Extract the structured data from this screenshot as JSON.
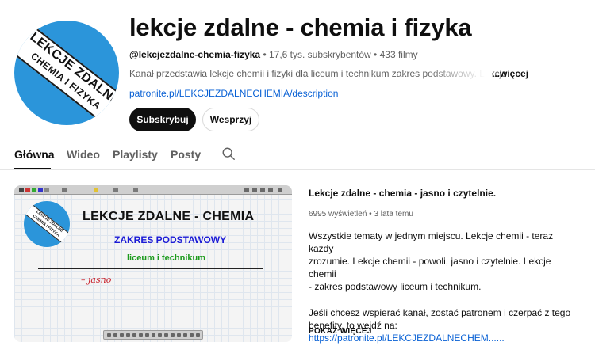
{
  "channel": {
    "title": "lekcje zdalne - chemia i fizyka",
    "handle": "@lekcjezdalne-chemia-fizyka",
    "subscribers": "17,6 tys. subskrybentów",
    "videos": "433 filmy",
    "separator": " • ",
    "description": "Kanał przedstawia lekcje chemii i fizyki dla liceum i technikum zakres podstawowy. Lekcje",
    "more_label": "...więcej",
    "link": "patronite.pl/LEKCJEZDALNECHEMIA/description",
    "avatar_text_line1": "LEKCJE ZDALNE",
    "avatar_text_line2": "CHEMIA I FIZYKA",
    "subscribe_label": "Subskrybuj",
    "support_label": "Wesprzyj"
  },
  "tabs": [
    {
      "label": "Główna",
      "active": true
    },
    {
      "label": "Wideo",
      "active": false
    },
    {
      "label": "Playlisty",
      "active": false
    },
    {
      "label": "Posty",
      "active": false
    }
  ],
  "featured": {
    "thumbnail": {
      "heading": "LEKCJE ZDALNE - CHEMIA",
      "subheading": "ZAKRES PODSTAWOWY",
      "subheading2": "liceum i technikum",
      "handwriting": "– jasno"
    },
    "title": "Lekcje zdalne - chemia - jasno i czytelnie.",
    "views": "6995 wyświetleń",
    "age": "3 lata temu",
    "description_lines": [
      "Wszystkie tematy w jednym miejscu. Lekcje chemii - teraz każdy",
      "zrozumie. Lekcje chemii - powoli, jasno i czytelnie. Lekcje chemii",
      "- zakres podstawowy liceum i technikum.",
      "Jeśli chcesz wspierać kanał, zostać patronem i czerpać z tego",
      "benefity, to wejdź na:"
    ],
    "description_link": "https://patronite.pl/LEKCJEZDALNECHEM......",
    "show_more_label": "POKAŻ WIĘCEJ"
  },
  "colors": {
    "accent_blue": "#2b95da",
    "link": "#065fd4",
    "text_primary": "#0f0f0f",
    "text_secondary": "#606060"
  },
  "icons": {
    "search": "search-icon"
  }
}
